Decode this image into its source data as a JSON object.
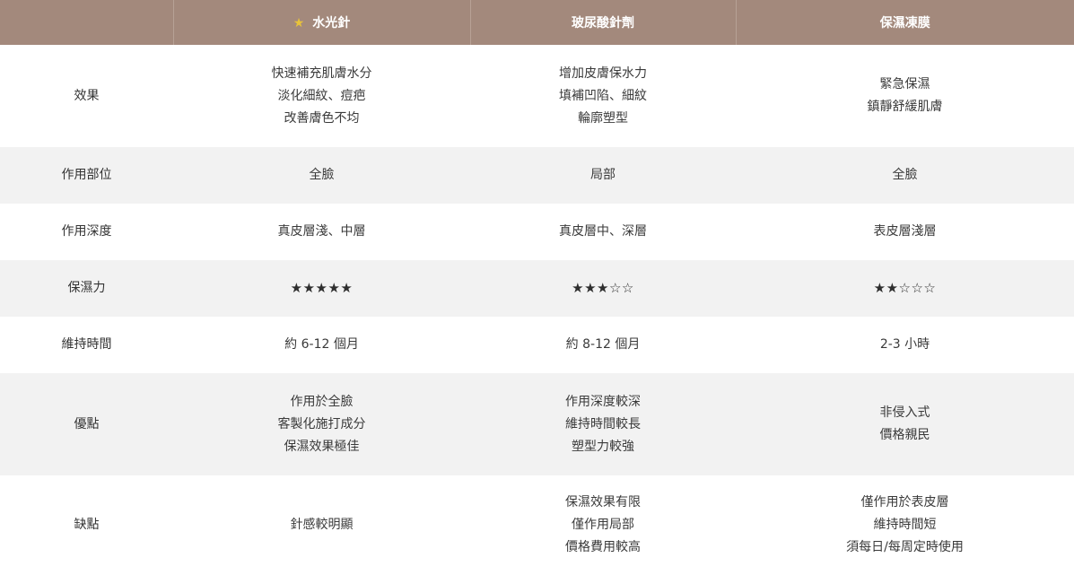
{
  "header": {
    "blank": "",
    "columns": [
      {
        "label": "水光針",
        "icon": "star-icon",
        "icon_color": "#e8c33a"
      },
      {
        "label": "玻尿酸針劑"
      },
      {
        "label": "保濕凍膜"
      }
    ],
    "background": "#a3897c"
  },
  "rows": [
    {
      "label": "效果",
      "cells": [
        [
          "快速補充肌膚水分",
          "淡化細紋、痘疤",
          "改善膚色不均"
        ],
        [
          "增加皮膚保水力",
          "填補凹陷、細紋",
          "輪廓塑型"
        ],
        [
          "緊急保濕",
          "鎮靜舒緩肌膚"
        ]
      ]
    },
    {
      "label": "作用部位",
      "cells": [
        [
          "全臉"
        ],
        [
          "局部"
        ],
        [
          "全臉"
        ]
      ]
    },
    {
      "label": "作用深度",
      "cells": [
        [
          "真皮層淺、中層"
        ],
        [
          "真皮層中、深層"
        ],
        [
          "表皮層淺層"
        ]
      ]
    },
    {
      "label": "保濕力",
      "cells": [
        [
          "★★★★★"
        ],
        [
          "★★★☆☆"
        ],
        [
          "★★☆☆☆"
        ]
      ],
      "ratings": [
        5,
        3,
        2
      ]
    },
    {
      "label": "維持時間",
      "cells": [
        [
          "約 6-12 個月"
        ],
        [
          "約 8-12 個月"
        ],
        [
          "2-3 小時"
        ]
      ]
    },
    {
      "label": "優點",
      "cells": [
        [
          "作用於全臉",
          "客製化施打成分",
          "保濕效果極佳"
        ],
        [
          "作用深度較深",
          "維持時間較長",
          "塑型力較強"
        ],
        [
          "非侵入式",
          "價格親民"
        ]
      ]
    },
    {
      "label": "缺點",
      "cells": [
        [
          "針感較明顯"
        ],
        [
          "保濕效果有限",
          "僅作用局部",
          "價格費用較高"
        ],
        [
          "僅作用於表皮層",
          "維持時間短",
          "須每日/每周定時使用"
        ]
      ]
    }
  ]
}
